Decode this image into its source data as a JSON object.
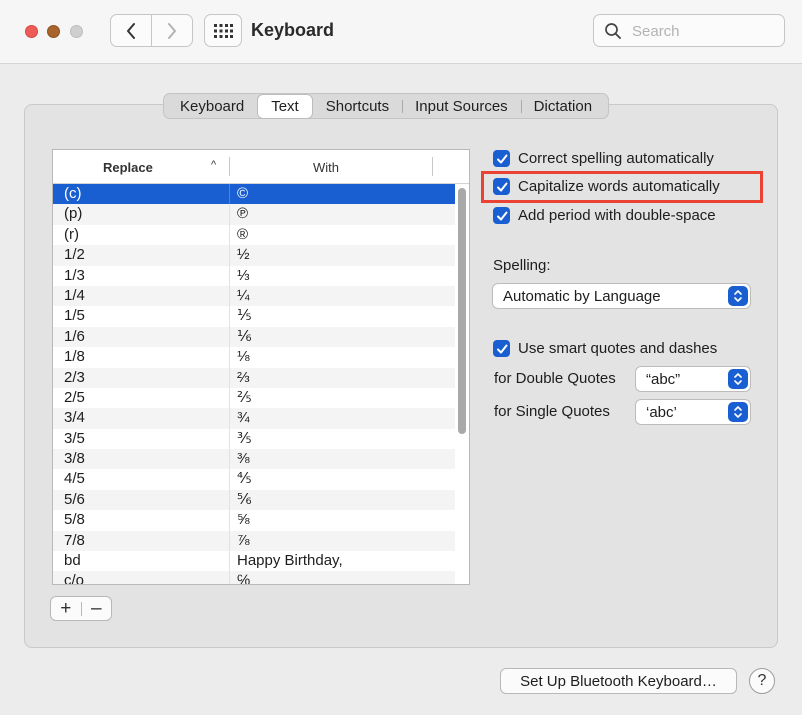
{
  "window": {
    "title": "Keyboard",
    "search_placeholder": "Search"
  },
  "tabs": [
    {
      "label": "Keyboard",
      "active": false
    },
    {
      "label": "Text",
      "active": true
    },
    {
      "label": "Shortcuts",
      "active": false
    },
    {
      "label": "Input Sources",
      "active": false
    },
    {
      "label": "Dictation",
      "active": false
    }
  ],
  "table": {
    "col_replace": "Replace",
    "col_with": "With",
    "sort_indicator": "^",
    "rows": [
      {
        "replace": "(c)",
        "with": "©",
        "selected": true
      },
      {
        "replace": "(p)",
        "with": "℗"
      },
      {
        "replace": "(r)",
        "with": "®"
      },
      {
        "replace": "1/2",
        "with": "½"
      },
      {
        "replace": "1/3",
        "with": "⅓"
      },
      {
        "replace": "1/4",
        "with": "¼"
      },
      {
        "replace": "1/5",
        "with": "⅕"
      },
      {
        "replace": "1/6",
        "with": "⅙"
      },
      {
        "replace": "1/8",
        "with": "⅛"
      },
      {
        "replace": "2/3",
        "with": "⅔"
      },
      {
        "replace": "2/5",
        "with": "⅖"
      },
      {
        "replace": "3/4",
        "with": "¾"
      },
      {
        "replace": "3/5",
        "with": "⅗"
      },
      {
        "replace": "3/8",
        "with": "⅜"
      },
      {
        "replace": "4/5",
        "with": "⅘"
      },
      {
        "replace": "5/6",
        "with": "⅚"
      },
      {
        "replace": "5/8",
        "with": "⅝"
      },
      {
        "replace": "7/8",
        "with": "⅞"
      },
      {
        "replace": "bd",
        "with": "Happy Birthday,"
      },
      {
        "replace": "c/o",
        "with": "℅"
      }
    ],
    "add_label": "+",
    "remove_label": "–"
  },
  "options": {
    "correct_spelling": {
      "label": "Correct spelling automatically",
      "checked": true
    },
    "capitalize_words": {
      "label": "Capitalize words automatically",
      "checked": true
    },
    "add_period": {
      "label": "Add period with double-space",
      "checked": true
    },
    "spelling_label": "Spelling:",
    "spelling_value": "Automatic by Language",
    "smart_quotes": {
      "label": "Use smart quotes and dashes",
      "checked": true
    },
    "double_quotes_label": "for Double Quotes",
    "double_quotes_value": "“abc”",
    "single_quotes_label": "for Single Quotes",
    "single_quotes_value": "‘abc’"
  },
  "footer": {
    "bluetooth_button": "Set Up Bluetooth Keyboard…",
    "help_label": "?"
  },
  "colors": {
    "accent": "#1a5fd1",
    "highlight": "#ea4333"
  }
}
